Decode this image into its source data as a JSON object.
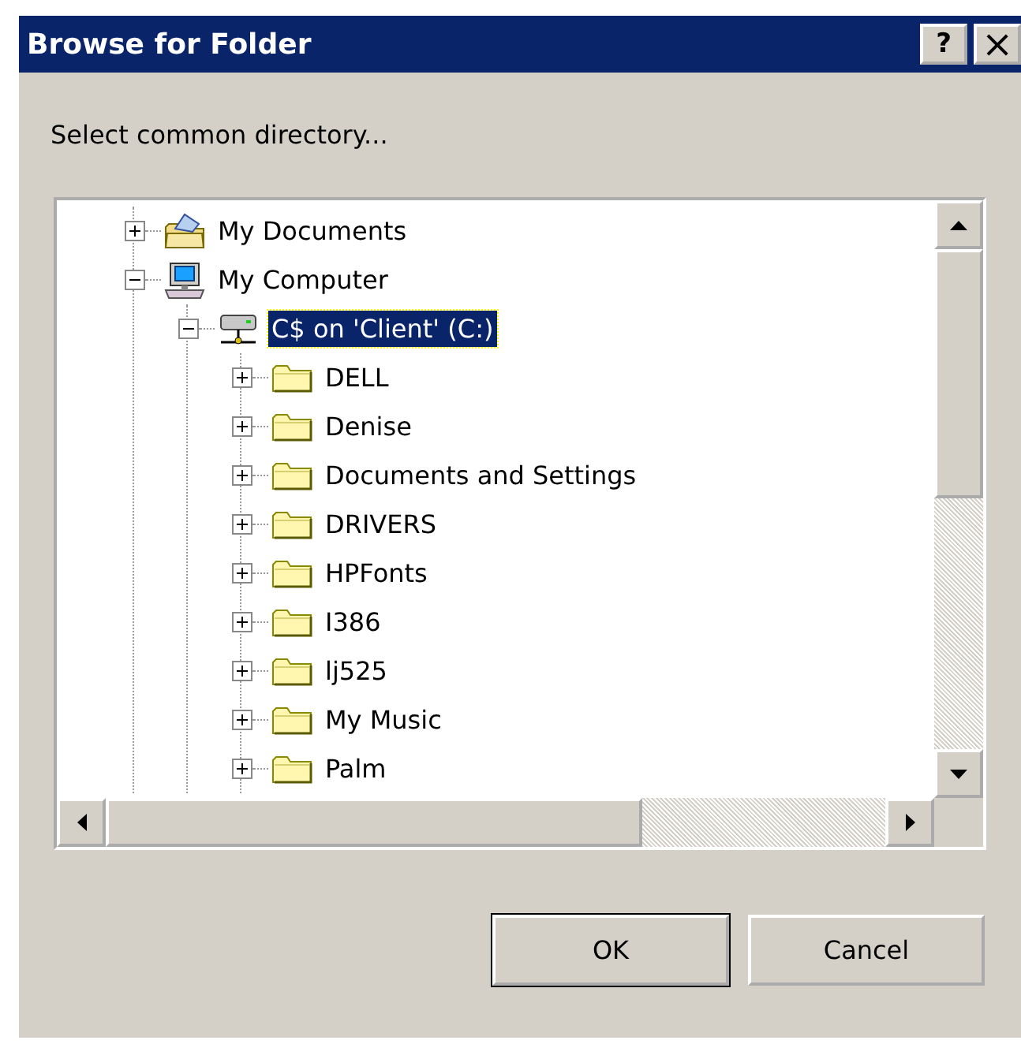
{
  "window": {
    "title": "Browse for Folder",
    "title_buttons": [
      {
        "kind": "help",
        "label": "?"
      },
      {
        "kind": "close",
        "label": "×"
      }
    ]
  },
  "prompt": "Select common directory...",
  "tree": [
    {
      "label": "My Documents",
      "kind": "documents",
      "expanded": false,
      "selected": false
    },
    {
      "label": "My Computer",
      "kind": "computer",
      "expanded": true,
      "selected": false,
      "children": [
        {
          "label": "C$ on 'Client' (C:)",
          "kind": "drive",
          "expanded": true,
          "selected": true,
          "children": [
            {
              "label": "DELL",
              "kind": "folder",
              "expanded": false,
              "selected": false
            },
            {
              "label": "Denise",
              "kind": "folder",
              "expanded": false,
              "selected": false
            },
            {
              "label": "Documents and Settings",
              "kind": "folder",
              "expanded": false,
              "selected": false
            },
            {
              "label": "DRIVERS",
              "kind": "folder",
              "expanded": false,
              "selected": false
            },
            {
              "label": "HPFonts",
              "kind": "folder",
              "expanded": false,
              "selected": false
            },
            {
              "label": "I386",
              "kind": "folder",
              "expanded": false,
              "selected": false
            },
            {
              "label": "lj525",
              "kind": "folder",
              "expanded": false,
              "selected": false
            },
            {
              "label": "My Music",
              "kind": "folder",
              "expanded": false,
              "selected": false
            },
            {
              "label": "Palm",
              "kind": "folder",
              "expanded": false,
              "selected": false
            }
          ]
        }
      ]
    }
  ],
  "buttons": [
    {
      "label": "OK",
      "default": true
    },
    {
      "label": "Cancel",
      "default": false
    }
  ]
}
